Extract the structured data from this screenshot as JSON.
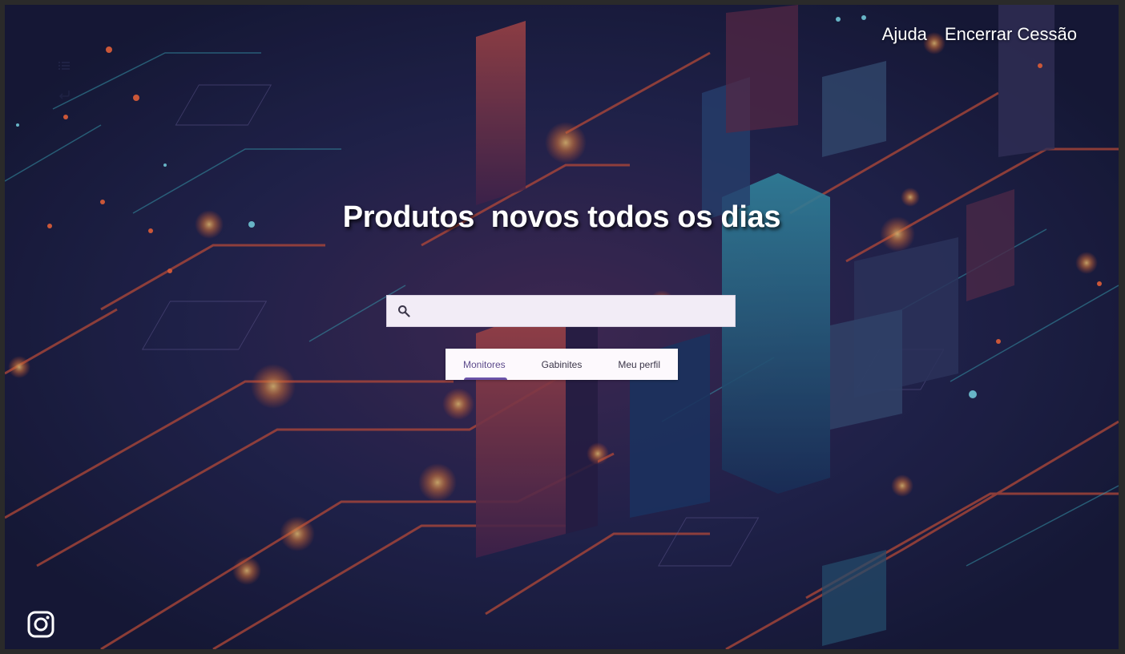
{
  "header": {
    "nav": [
      {
        "label": "Ajuda"
      },
      {
        "label": "Encerrar Cessão"
      }
    ]
  },
  "sidebar": {
    "icons": [
      "list-icon",
      "return-icon"
    ]
  },
  "hero": {
    "title": "Produtos  novos todos os dias"
  },
  "search": {
    "value": "",
    "placeholder": "",
    "icon": "search-icon"
  },
  "tabs": [
    {
      "label": "Monitores",
      "active": true
    },
    {
      "label": "Gabinites",
      "active": false
    },
    {
      "label": "Meu perfil",
      "active": false
    }
  ],
  "footer": {
    "social_icon": "instagram-icon"
  },
  "colors": {
    "tab_accent": "#6a52a8",
    "search_bg": "#f2ecf6",
    "tabs_bg": "#fdf9fd"
  }
}
